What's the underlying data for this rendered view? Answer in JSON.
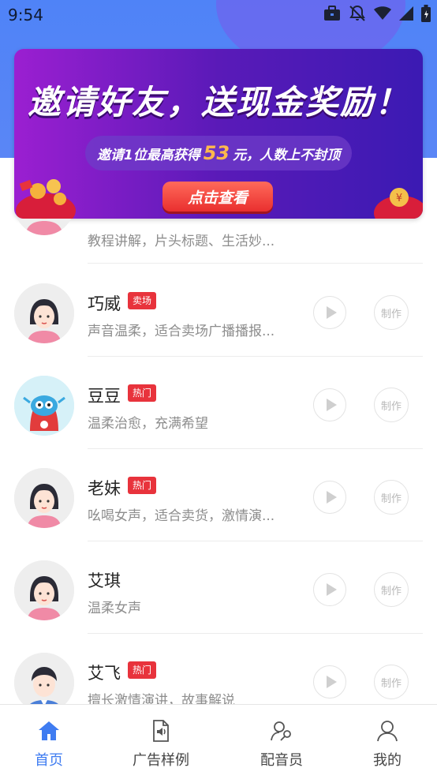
{
  "status_bar": {
    "time": "9:54"
  },
  "banner": {
    "title": "邀请好友，送现金奖励！",
    "subtitle_prefix": "邀请1位最高获得",
    "subtitle_amount": "53",
    "subtitle_suffix": "元，人数上不封顶",
    "cta": "点击查看"
  },
  "list": {
    "items": [
      {
        "name": "",
        "tag": "",
        "desc": "教程讲解，片头标题、生活妙...",
        "make": ""
      },
      {
        "name": "巧威",
        "tag": "卖场",
        "desc": "声音温柔，适合卖场广播播报...",
        "make": "制作"
      },
      {
        "name": "豆豆",
        "tag": "热门",
        "desc": "温柔治愈，充满希望",
        "make": "制作"
      },
      {
        "name": "老妹",
        "tag": "热门",
        "desc": "吆喝女声，适合卖货，激情演...",
        "make": "制作"
      },
      {
        "name": "艾琪",
        "tag": "",
        "desc": "温柔女声",
        "make": "制作"
      },
      {
        "name": "艾飞",
        "tag": "热门",
        "desc": "擅长激情演讲，故事解说",
        "make": "制作"
      }
    ]
  },
  "bottom_nav": {
    "items": [
      {
        "label": "首页",
        "icon": "home-icon",
        "active": true
      },
      {
        "label": "广告样例",
        "icon": "audio-file-icon",
        "active": false
      },
      {
        "label": "配音员",
        "icon": "voice-actor-icon",
        "active": false
      },
      {
        "label": "我的",
        "icon": "user-icon",
        "active": false
      }
    ]
  },
  "colors": {
    "accent": "#3f7cf1",
    "tag_red": "#e8333c",
    "header_blue": "#4f83f7"
  }
}
